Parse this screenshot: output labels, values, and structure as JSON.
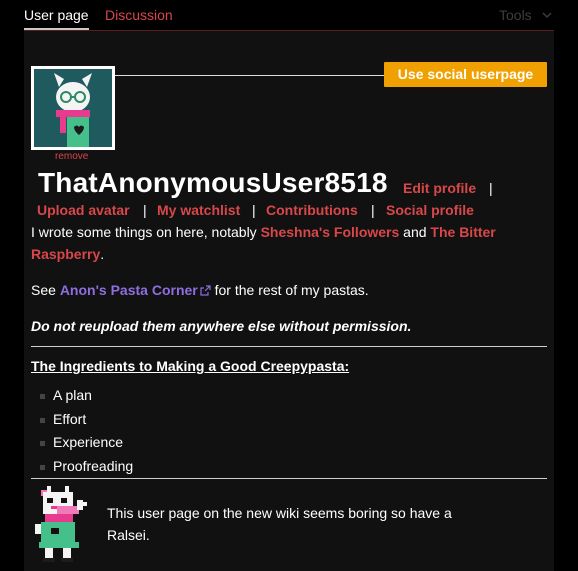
{
  "tabs": {
    "user_page": "User page",
    "discussion": "Discussion",
    "tools": "Tools"
  },
  "profile": {
    "social_button": "Use social userpage",
    "remove_label": "remove",
    "username": "ThatAnonymousUser8518",
    "edit_profile": "Edit profile",
    "links": [
      "Upload avatar",
      "My watchlist",
      "Contributions",
      "Social profile"
    ],
    "separator": "|"
  },
  "body": {
    "intro_prefix": "I wrote some things on here, notably ",
    "link_followers": "Sheshna's Followers",
    "intro_and": " and ",
    "link_bitter": "The Bitter",
    "link_bitter_2": "Raspberry",
    "intro_end": ".",
    "see_prefix": "See ",
    "link_pasta_corner": "Anon's Pasta Corner",
    "see_suffix": " for the rest of my pastas.",
    "warning": "Do not reupload them anywhere else without permission.",
    "heading": "The Ingredients to Making a Good Creepypasta:",
    "ingredients": [
      "A plan",
      "Effort",
      "Experience",
      "Proofreading"
    ],
    "ralsei_text": "This user page on the new wiki seems boring so have a Ralsei."
  },
  "colors": {
    "background": "#000000",
    "panel": "#111111",
    "accent_red": "#d8474a",
    "accent_purple": "#8e6ee0",
    "button_orange": "#f0a000"
  },
  "icons": {
    "tools_chevron": "chevron-down-icon",
    "external_link": "external-link-icon"
  }
}
